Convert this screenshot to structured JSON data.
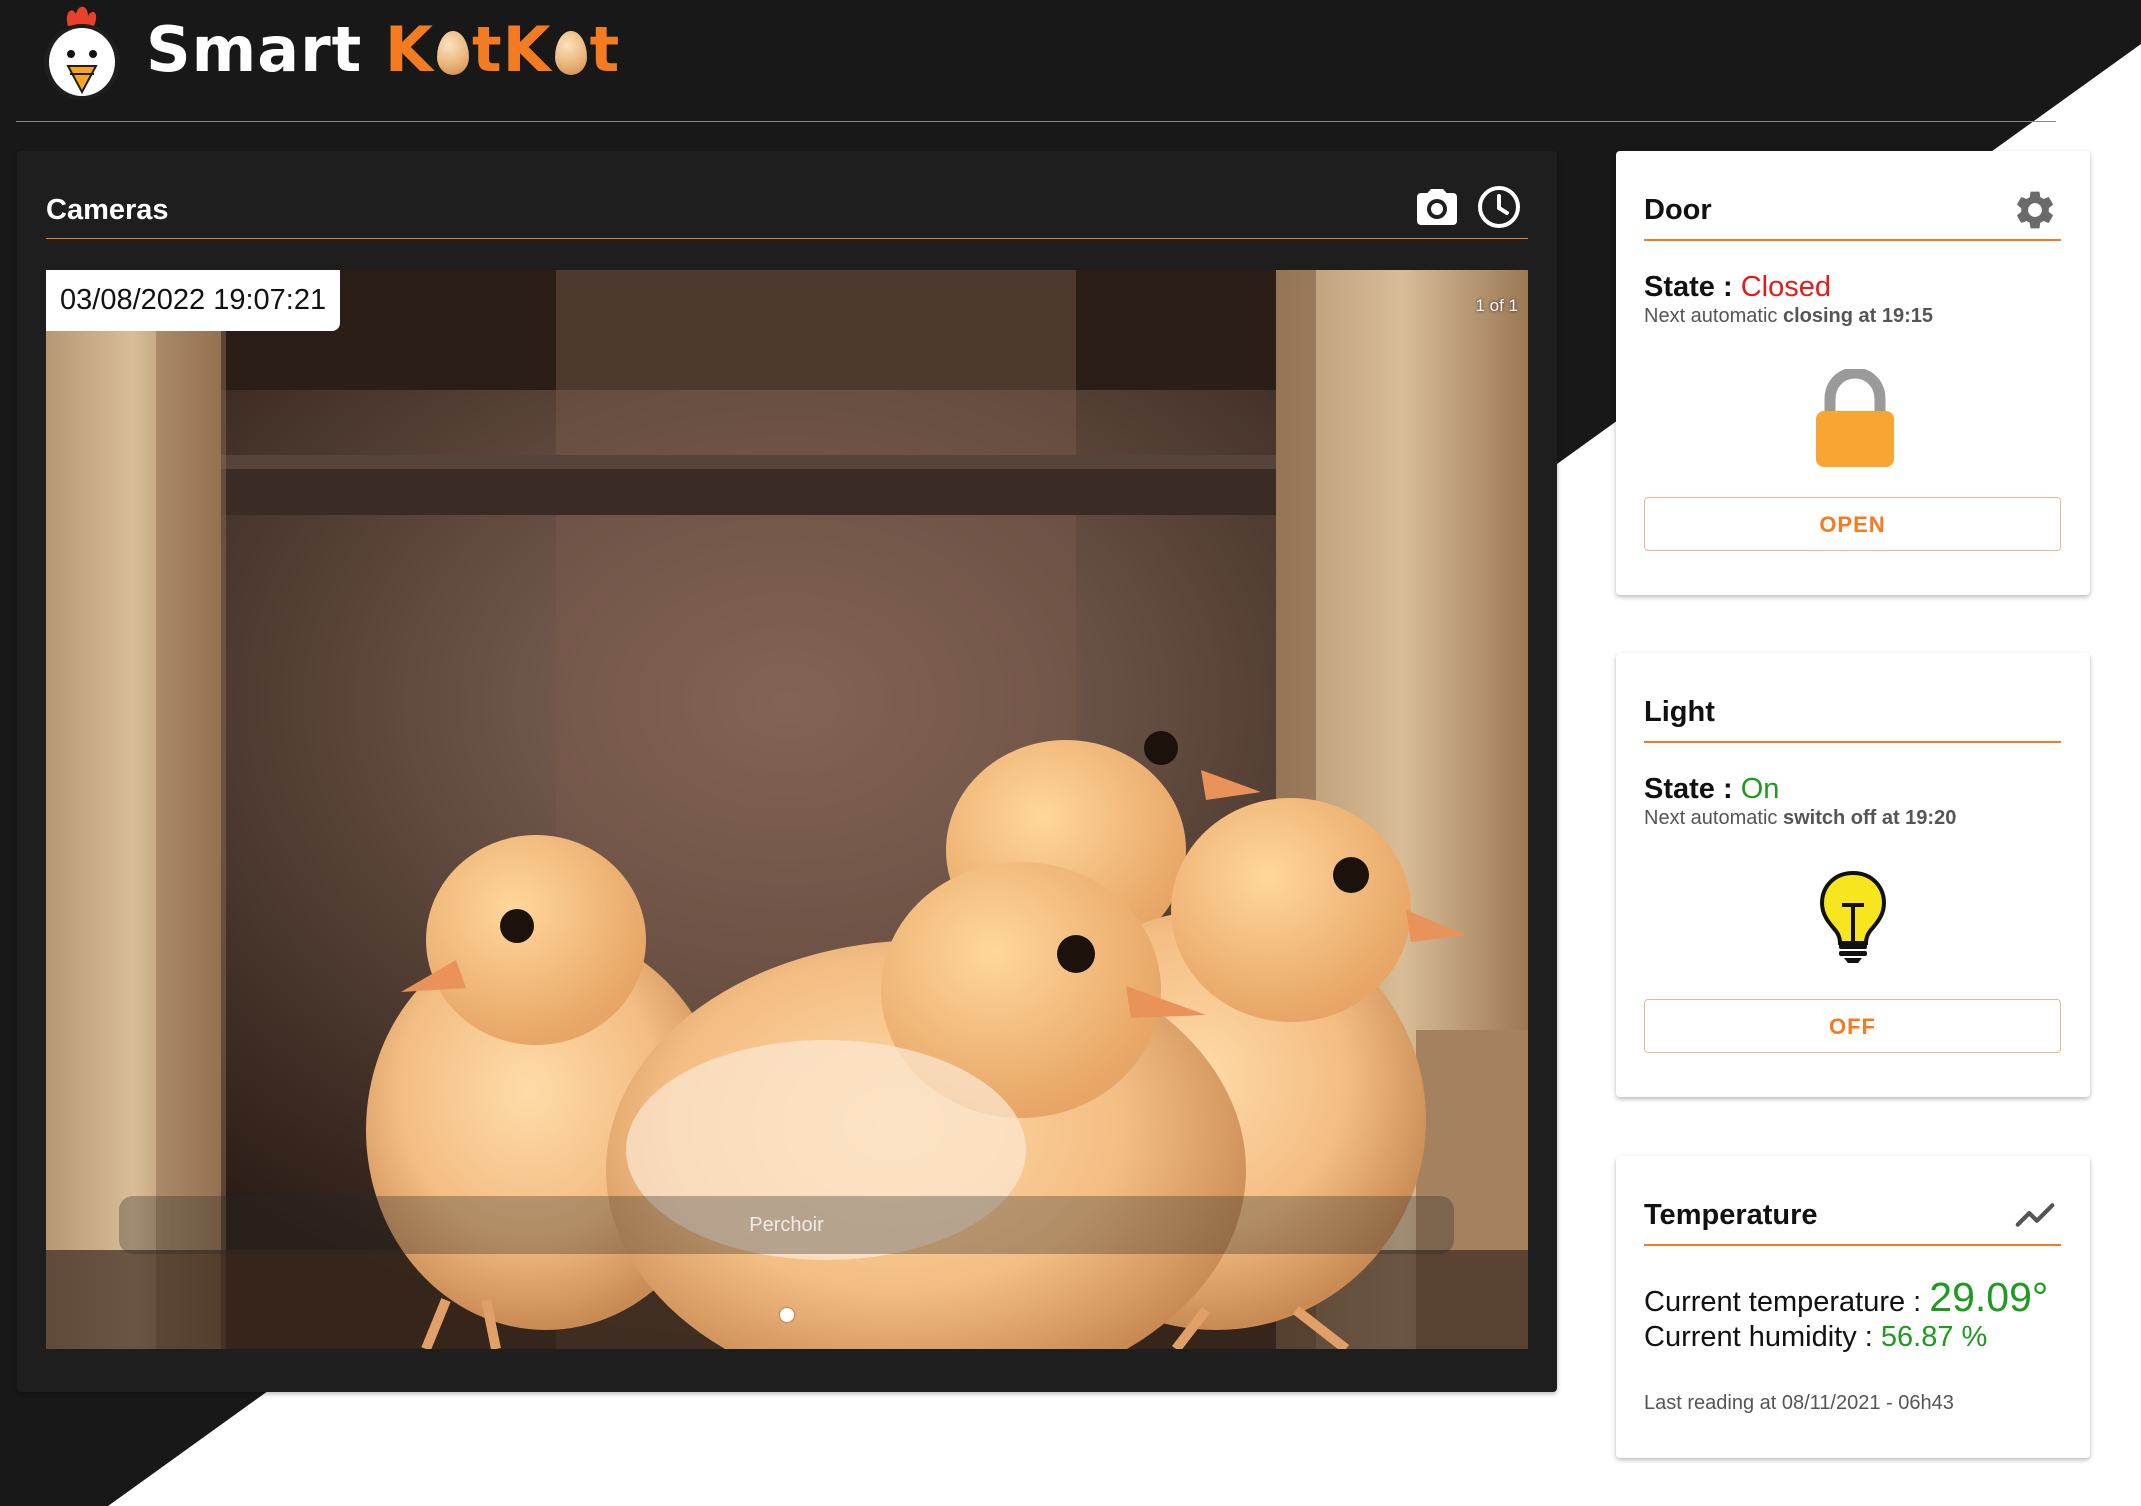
{
  "app": {
    "brand_prefix": "Smart",
    "brand_part1": "K",
    "brand_part2": "tK",
    "brand_part3": "t",
    "logo_icon": "chicken-logo-icon",
    "egg_icon": "egg-icon"
  },
  "colors": {
    "accent": "#f47c20",
    "header_bg": "#181818",
    "card_dark_bg": "#1e1e1e",
    "card_light_bg": "#ffffff",
    "state_closed": "#e31b1b",
    "state_on": "#1e9a1e",
    "lock_color": "#f9a531",
    "bulb_color": "#f7e51e"
  },
  "cameras": {
    "title": "Cameras",
    "take_photo_icon": "camera-icon",
    "history_icon": "clock-icon",
    "timestamp": "03/08/2022 19:07:21",
    "counter": "1 of 1",
    "caption": "Perchoir",
    "slide_count": 1,
    "active_slide": 1
  },
  "door": {
    "title": "Door",
    "settings_icon": "gear-icon",
    "state_label": "State :",
    "state_value": "Closed",
    "next_prefix": "Next automatic",
    "next_bold": "closing at 19:15",
    "state_icon": "lock-icon",
    "button_label": "OPEN"
  },
  "light": {
    "title": "Light",
    "state_label": "State :",
    "state_value": "On",
    "next_prefix": "Next automatic",
    "next_bold": "switch off at 19:20",
    "state_icon": "lightbulb-icon",
    "button_label": "OFF"
  },
  "temperature": {
    "title": "Temperature",
    "chart_icon": "trending-icon",
    "temp_label": "Current temperature :",
    "temp_value": "29.09°",
    "humidity_label": "Current humidity :",
    "humidity_value": "56.87 %",
    "last_reading": "Last reading at 08/11/2021 - 06h43"
  }
}
